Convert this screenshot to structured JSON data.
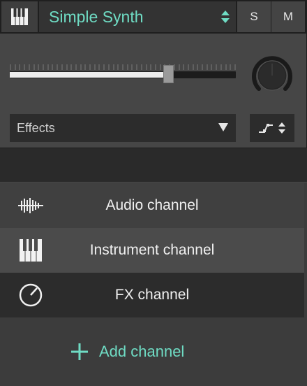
{
  "track": {
    "instrument_name": "Simple Synth",
    "solo_label": "S",
    "mute_label": "M",
    "volume_level": 0.7,
    "effects_label": "Effects",
    "icons": {
      "instrument": "piano-keys-icon",
      "select_arrows": "updown-arrows-icon",
      "effects_caret": "caret-down-icon",
      "routing": "routing-step-icon"
    }
  },
  "add_menu": {
    "options": [
      {
        "label": "Audio channel",
        "icon": "audio-waveform-icon"
      },
      {
        "label": "Instrument channel",
        "icon": "piano-keys-icon"
      },
      {
        "label": "FX channel",
        "icon": "fx-knob-icon"
      }
    ],
    "add_label": "Add channel",
    "add_icon": "plus-icon"
  },
  "colors": {
    "accent": "#6fdcc4",
    "panel": "#464646",
    "background": "#2a2a2a"
  }
}
